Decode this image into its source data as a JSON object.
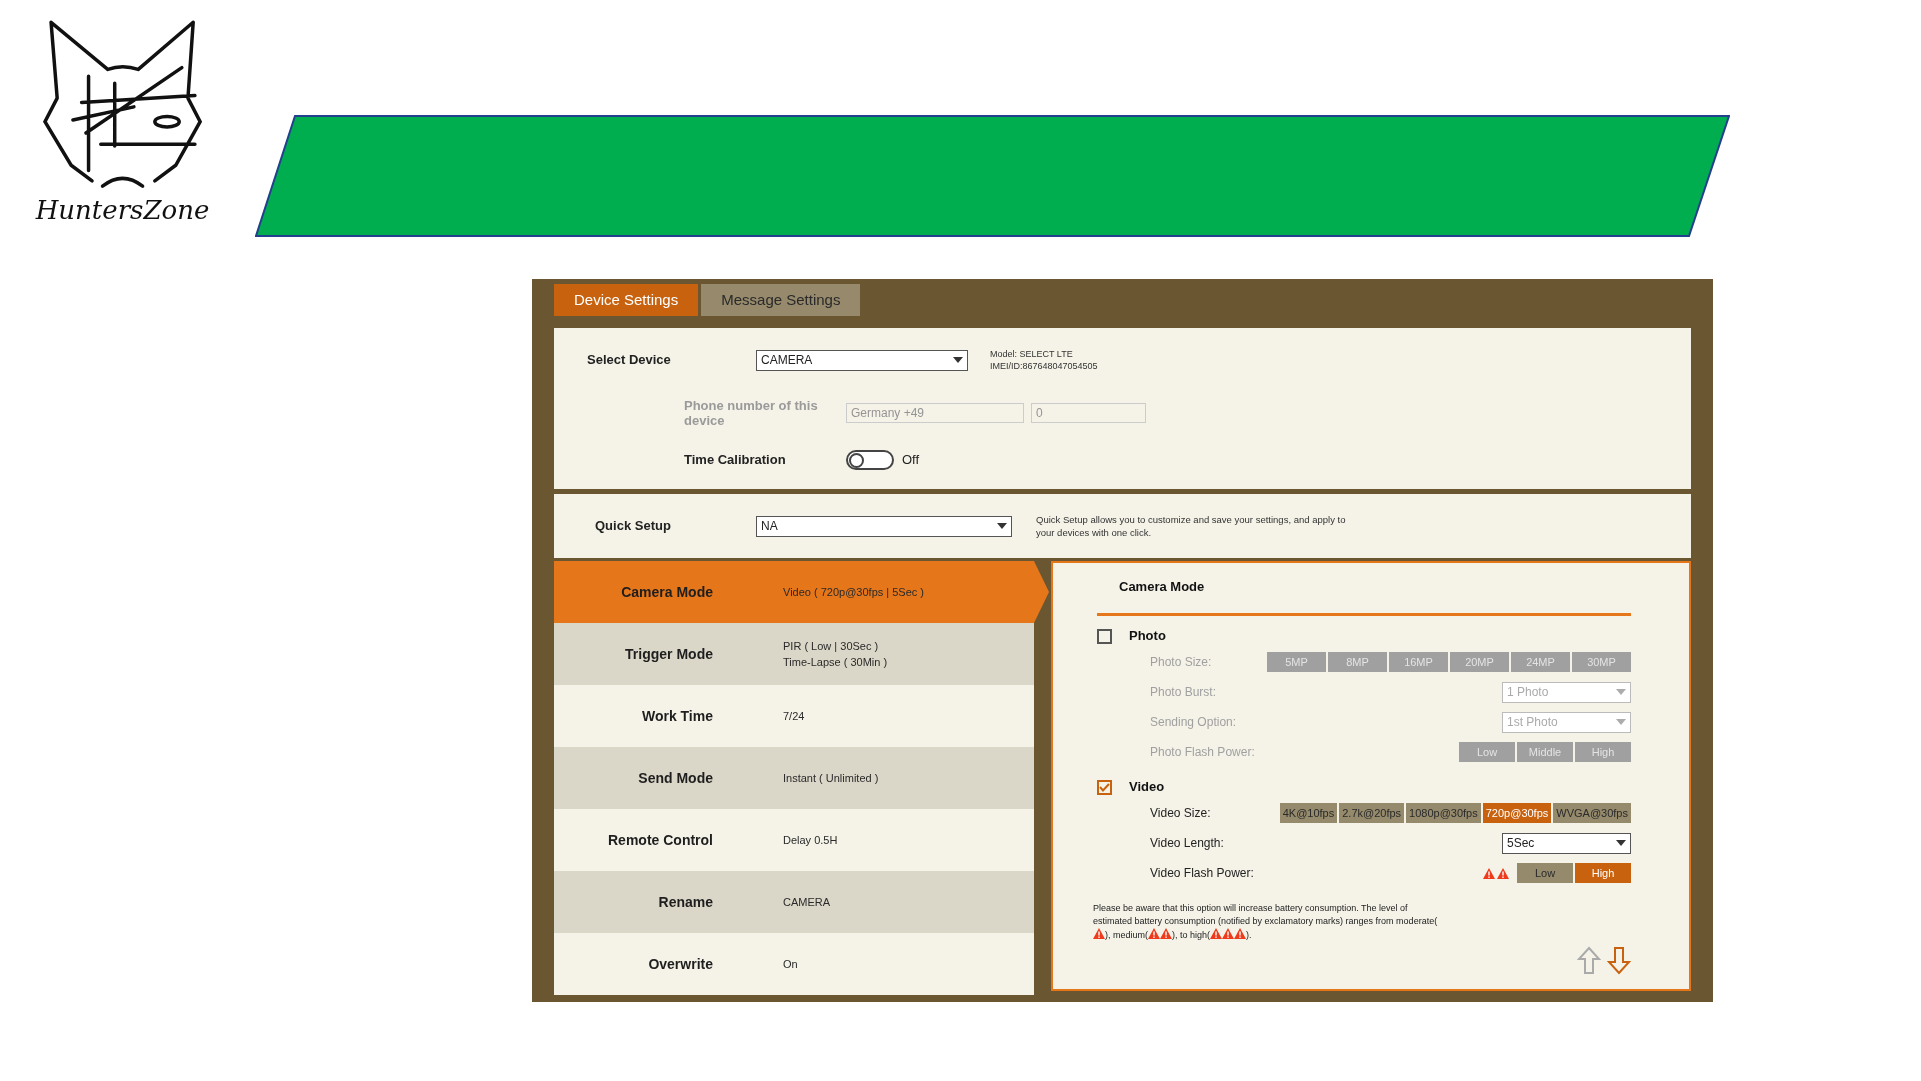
{
  "logo": {
    "text": "HuntersZone"
  },
  "tabs": [
    {
      "label": "Device Settings",
      "selected": true
    },
    {
      "label": "Message Settings",
      "selected": false
    }
  ],
  "device": {
    "label": "Select Device",
    "value": "CAMERA",
    "info": [
      "Model: SELECT LTE",
      "IMEI/ID:867648047054505"
    ]
  },
  "phone": {
    "label": "Phone number of this device",
    "disabled": true,
    "country": "Germany +49",
    "number": "0"
  },
  "time_calibration": {
    "label": "Time Calibration",
    "on": false,
    "state_text": "Off"
  },
  "quick_setup": {
    "label": "Quick Setup",
    "value": "NA",
    "hint": "Quick Setup allows you to customize and save your settings, and apply to your devices with one click."
  },
  "settings": [
    {
      "label": "Camera Mode",
      "value": [
        "Video ( 720p@30fps | 5Sec )"
      ],
      "selected": true
    },
    {
      "label": "Trigger Mode",
      "value": [
        "PIR ( Low | 30Sec )",
        "Time-Lapse ( 30Min )"
      ],
      "selected": false
    },
    {
      "label": "Work Time",
      "value": [
        "7/24"
      ],
      "selected": false
    },
    {
      "label": "Send Mode",
      "value": [
        "Instant ( Unlimited )"
      ],
      "selected": false
    },
    {
      "label": "Remote Control",
      "value": [
        "Delay 0.5H"
      ],
      "selected": false
    },
    {
      "label": "Rename",
      "value": [
        "CAMERA"
      ],
      "selected": false
    },
    {
      "label": "Overwrite",
      "value": [
        "On"
      ],
      "selected": false
    }
  ],
  "camera_mode": {
    "title": "Camera Mode",
    "sections": [
      {
        "label": "Photo",
        "checked": false,
        "options": [
          {
            "kind": "buttons",
            "label": "Photo Size:",
            "buttons": [
              {
                "label": "5MP",
                "selected": false
              },
              {
                "label": "8MP",
                "selected": false
              },
              {
                "label": "16MP",
                "selected": false
              },
              {
                "label": "20MP",
                "selected": false
              },
              {
                "label": "24MP",
                "selected": false
              },
              {
                "label": "30MP",
                "selected": false
              }
            ]
          },
          {
            "kind": "select",
            "label": "Photo Burst:",
            "value": "1 Photo"
          },
          {
            "kind": "select",
            "label": "Sending Option:",
            "value": "1st Photo"
          },
          {
            "kind": "buttons",
            "label": "Photo Flash Power:",
            "buttons": [
              {
                "label": "Low",
                "selected": false
              },
              {
                "label": "Middle",
                "selected": false
              },
              {
                "label": "High",
                "selected": false
              }
            ]
          }
        ]
      },
      {
        "label": "Video",
        "checked": true,
        "options": [
          {
            "kind": "buttons",
            "label": "Video Size:",
            "buttons": [
              {
                "label": "4K@10fps",
                "selected": false
              },
              {
                "label": "2.7k@20fps",
                "selected": false
              },
              {
                "label": "1080p@30fps",
                "selected": false
              },
              {
                "label": "720p@30fps",
                "selected": true
              },
              {
                "label": "WVGA@30fps",
                "selected": false
              }
            ]
          },
          {
            "kind": "select",
            "label": "Video Length:",
            "value": "5Sec"
          },
          {
            "kind": "buttons",
            "label": "Video Flash Power:",
            "icons": [
              {
                "kind": "warning"
              },
              {
                "kind": "warning"
              }
            ],
            "buttons": [
              {
                "label": "Low",
                "selected": false
              },
              {
                "label": "High",
                "selected": true
              }
            ]
          }
        ]
      }
    ],
    "note": [
      {
        "kind": "text",
        "text": "Please be aware that this option will increase battery consumption. The level of estimated battery consumption (notified by exclamatory marks) ranges from moderate("
      },
      {
        "kind": "warning"
      },
      {
        "kind": "text",
        "text": "), medium("
      },
      {
        "kind": "warning"
      },
      {
        "kind": "warning"
      },
      {
        "kind": "text",
        "text": "), to high("
      },
      {
        "kind": "warning"
      },
      {
        "kind": "warning"
      },
      {
        "kind": "warning"
      },
      {
        "kind": "text",
        "text": ")."
      }
    ],
    "nav": [
      {
        "kind": "up",
        "disabled": true
      },
      {
        "kind": "down",
        "disabled": false
      }
    ]
  }
}
